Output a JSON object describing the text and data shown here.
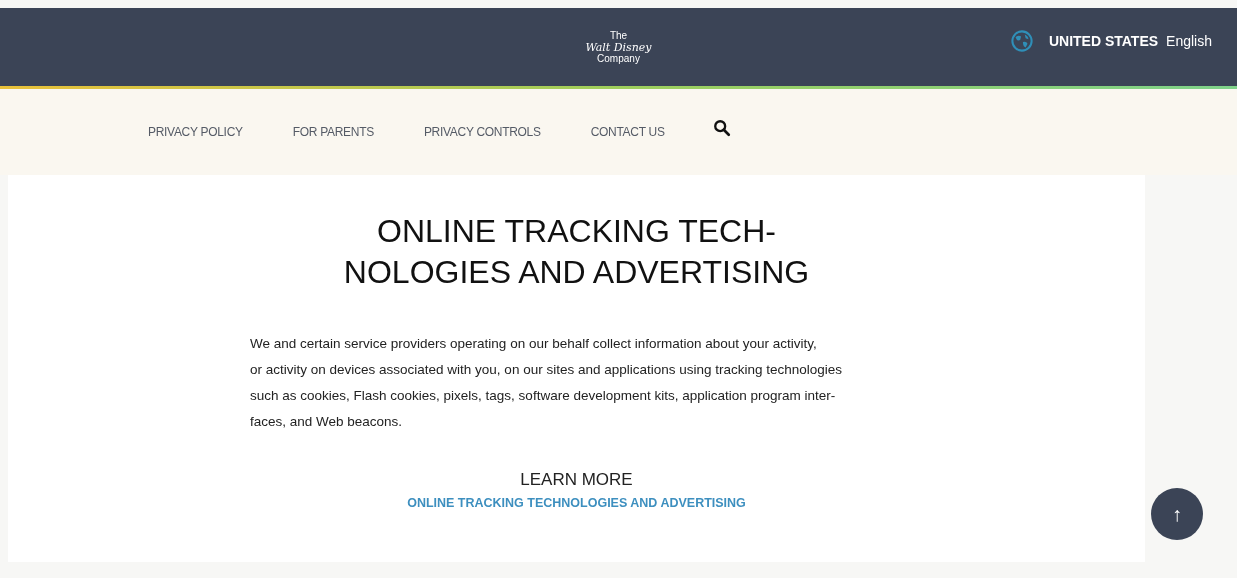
{
  "header": {
    "logo": {
      "top": "The",
      "middle": "Walt Disney",
      "bottom": "Company"
    },
    "region": {
      "country": "UNITED STATES",
      "language": "English"
    }
  },
  "nav": {
    "items": [
      {
        "label": "PRIVACY POLICY"
      },
      {
        "label": "FOR PARENTS"
      },
      {
        "label": "PRIVACY CONTROLS"
      },
      {
        "label": "CONTACT US"
      }
    ]
  },
  "article": {
    "title_lines": [
      "ONLINE TRACKING TECH-",
      "NOLOGIES AND ADVERTISING"
    ],
    "paragraph_lines": [
      "We and certain service providers operating on our behalf collect information about your activity,",
      "or activity on devices associated with you, on our sites and applications using tracking technologies",
      "such as cookies, Flash cookies, pixels, tags, software development kits, application program inter-",
      "faces, and Web beacons."
    ],
    "learn_more": {
      "heading": "LEARN MORE",
      "link": "ONLINE TRACKING TECHNOLOGIES AND ADVERTISING"
    }
  },
  "back_to_top": {
    "symbol": "↑"
  }
}
